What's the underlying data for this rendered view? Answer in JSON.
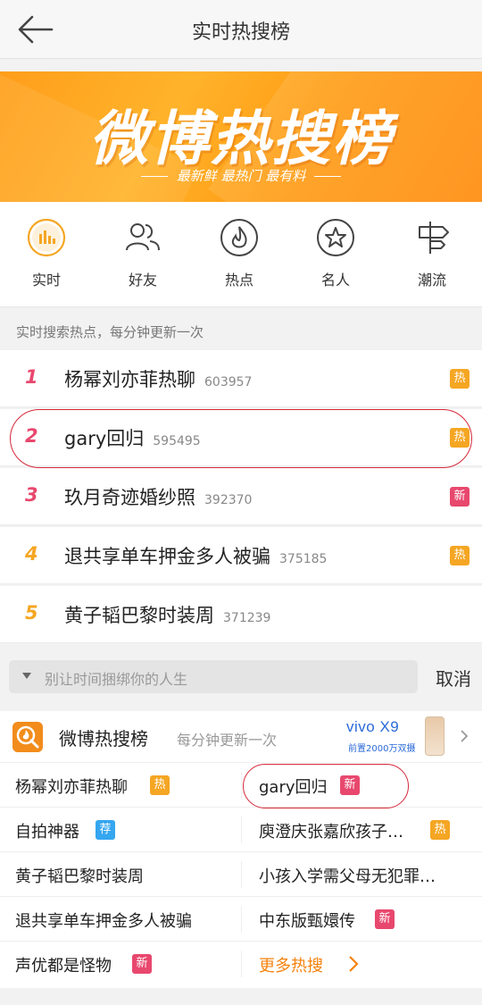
{
  "header": {
    "title": "实时热搜榜"
  },
  "banner": {
    "title": "微博热搜榜",
    "subtitle": "最新鲜 最热门 最有料"
  },
  "categories": [
    {
      "label": "实时",
      "icon": "bar-chart-icon"
    },
    {
      "label": "好友",
      "icon": "friends-icon"
    },
    {
      "label": "热点",
      "icon": "flame-icon"
    },
    {
      "label": "名人",
      "icon": "star-icon"
    },
    {
      "label": "潮流",
      "icon": "signpost-icon"
    }
  ],
  "notice": "实时搜索热点，每分钟更新一次",
  "ranking": [
    {
      "rank": "1",
      "name": "杨幂刘亦菲热聊",
      "count": "603957",
      "badge": "热",
      "badge_type": "hot",
      "rank_color": "#e8486e"
    },
    {
      "rank": "2",
      "name": "gary回归",
      "count": "595495",
      "badge": "热",
      "badge_type": "hot",
      "rank_color": "#e8486e"
    },
    {
      "rank": "3",
      "name": "玖月奇迹婚纱照",
      "count": "392370",
      "badge": "新",
      "badge_type": "new",
      "rank_color": "#e8486e"
    },
    {
      "rank": "4",
      "name": "退共享单车押金多人被骗",
      "count": "375185",
      "badge": "热",
      "badge_type": "hot",
      "rank_color": "#f5a623"
    },
    {
      "rank": "5",
      "name": "黄子韬巴黎时装周",
      "count": "371239",
      "badge": "",
      "badge_type": "",
      "rank_color": "#f5a623"
    }
  ],
  "search": {
    "placeholder": "别让时间捆绑你的人生",
    "cancel": "取消"
  },
  "panel": {
    "title": "微博热搜榜",
    "subtitle": "每分钟更新一次",
    "ad": {
      "brand": "vivo X9",
      "tag": "前置2000万双摄"
    },
    "items": [
      {
        "text": "杨幂刘亦菲热聊",
        "badge": "热",
        "badge_type": "hot"
      },
      {
        "text": "gary回归",
        "badge": "新",
        "badge_type": "new"
      },
      {
        "text": "自拍神器",
        "badge": "荐",
        "badge_type": "rec"
      },
      {
        "text": "庾澄庆张嘉欣孩子…",
        "badge": "热",
        "badge_type": "hot"
      },
      {
        "text": "黄子韬巴黎时装周",
        "badge": "",
        "badge_type": ""
      },
      {
        "text": "小孩入学需父母无犯罪…",
        "badge": "",
        "badge_type": ""
      },
      {
        "text": "退共享单车押金多人被骗",
        "badge": "",
        "badge_type": ""
      },
      {
        "text": "中东版甄嬛传",
        "badge": "新",
        "badge_type": "new"
      },
      {
        "text": "声优都是怪物",
        "badge": "新",
        "badge_type": "new"
      },
      {
        "text": "更多热搜",
        "badge": "",
        "badge_type": "more"
      }
    ]
  },
  "colors": {
    "accent": "#f5820d",
    "hot": "#f5a623",
    "new": "#e8486e",
    "rec": "#35a6f0",
    "annotation": "#d6283a"
  }
}
